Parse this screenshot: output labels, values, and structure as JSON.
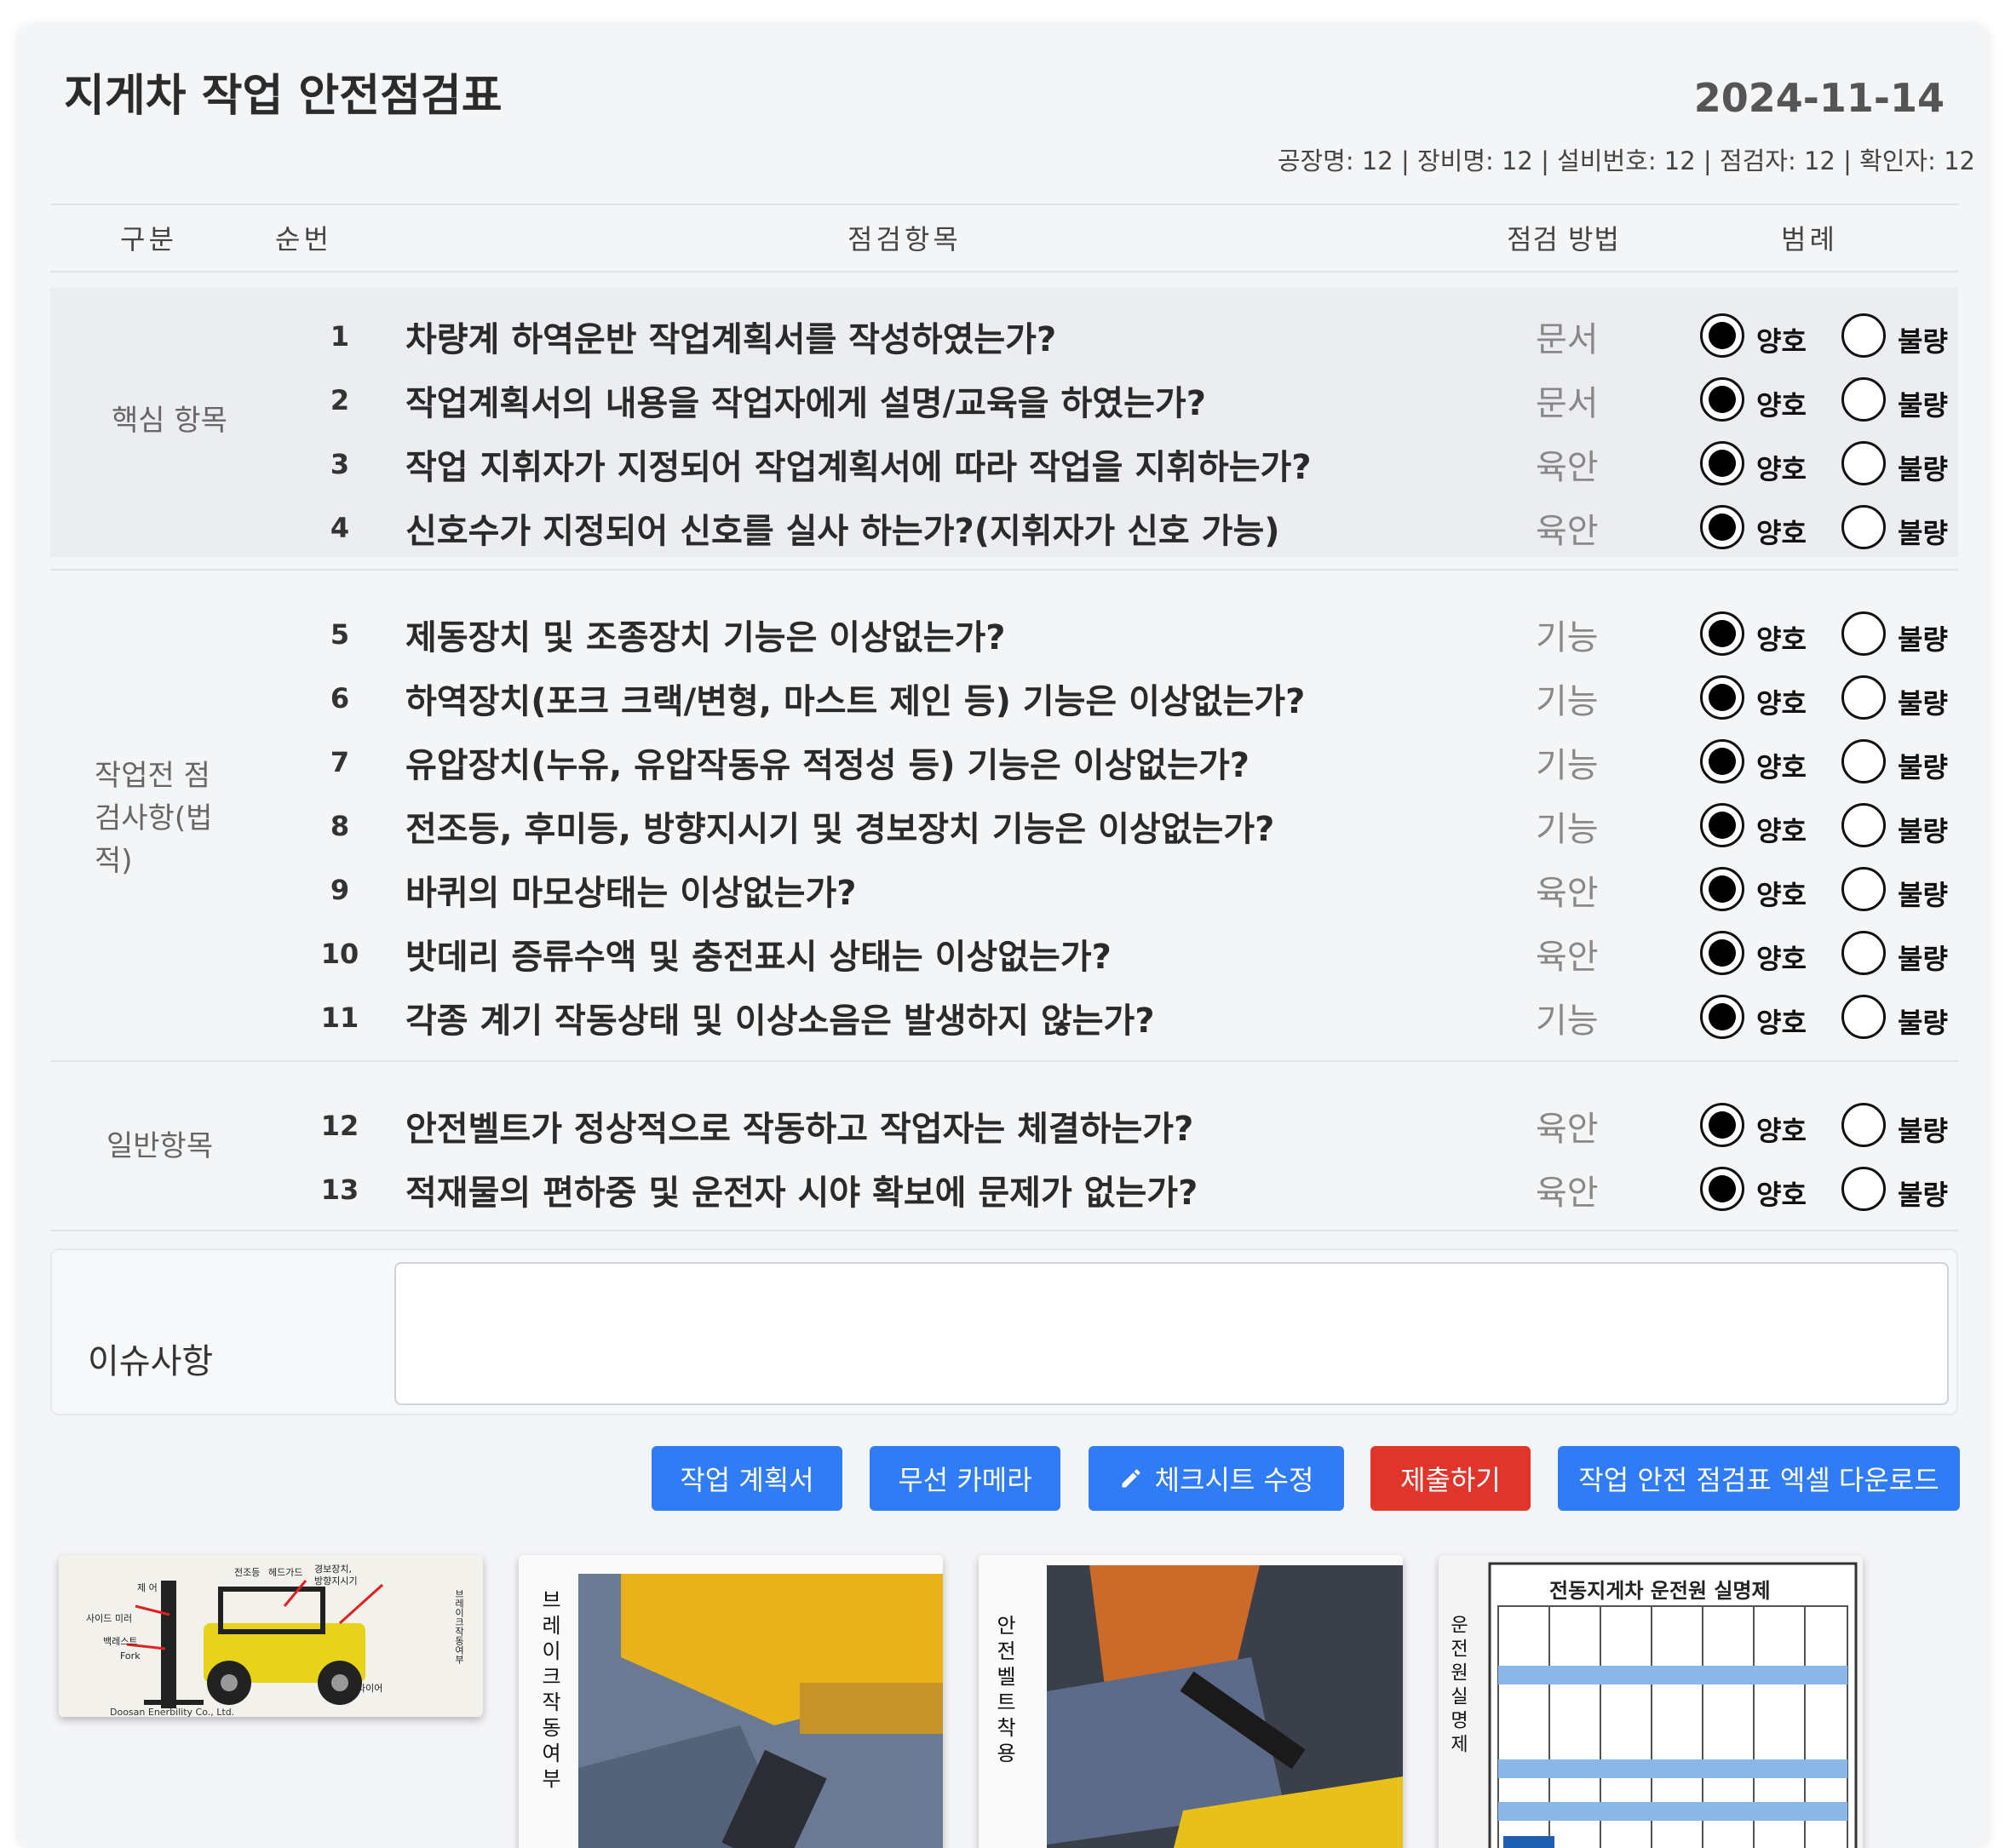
{
  "title": "지게차 작업 안전점검표",
  "date": "2024-11-14",
  "meta": [
    {
      "label": "공장명: 12 | "
    },
    {
      "label": "장비명: 12 | "
    },
    {
      "label": "설비번호: 12 | "
    },
    {
      "label": "점검자: 12 | "
    },
    {
      "label": "확인자: 12"
    }
  ],
  "columns": {
    "category": "구분",
    "number": "순번",
    "item": "점검항목",
    "method": "점검 방법",
    "legend": "범례"
  },
  "options": {
    "good": "양호",
    "bad": "불량"
  },
  "sections": [
    {
      "label": "핵심 항목",
      "rows": [
        {
          "num": "1",
          "question": "차량계 하역운반 작업계획서를 작성하였는가?",
          "method": "문서",
          "good": true
        },
        {
          "num": "2",
          "question": "작업계획서의 내용을 작업자에게 설명/교육을 하였는가?",
          "method": "문서",
          "good": true
        },
        {
          "num": "3",
          "question": "작업 지휘자가 지정되어 작업계획서에 따라 작업을 지휘하는가?",
          "method": "육안",
          "good": true
        },
        {
          "num": "4",
          "question": "신호수가 지정되어 신호를 실사 하는가?(지휘자가 신호 가능)",
          "method": "육안",
          "good": true
        }
      ]
    },
    {
      "label": "작업전 점검사항(법적)",
      "label_lines": [
        "작업전 점",
        "검사항(법",
        "적)"
      ],
      "rows": [
        {
          "num": "5",
          "question": "제동장치 및 조종장치 기능은 이상없는가?",
          "method": "기능",
          "good": true
        },
        {
          "num": "6",
          "question": "하역장치(포크 크랙/변형, 마스트 제인 등) 기능은 이상없는가?",
          "method": "기능",
          "good": true
        },
        {
          "num": "7",
          "question": "유압장치(누유, 유압작동유 적정성 등) 기능은 이상없는가?",
          "method": "기능",
          "good": true
        },
        {
          "num": "8",
          "question": "전조등, 후미등, 방향지시기 및 경보장치 기능은 이상없는가?",
          "method": "기능",
          "good": true
        },
        {
          "num": "9",
          "question": "바퀴의 마모상태는 이상없는가?",
          "method": "육안",
          "good": true
        },
        {
          "num": "10",
          "question": "밧데리 증류수액 및 충전표시 상태는 이상없는가?",
          "method": "육안",
          "good": true
        },
        {
          "num": "11",
          "question": "각종 계기 작동상태 및 이상소음은 발생하지 않는가?",
          "method": "기능",
          "good": true
        }
      ]
    },
    {
      "label": "일반항목",
      "rows": [
        {
          "num": "12",
          "question": "안전벨트가 정상적으로 작동하고 작업자는 체결하는가?",
          "method": "육안",
          "good": true
        },
        {
          "num": "13",
          "question": "적재물의 편하중 및 운전자 시야 확보에 문제가 없는가?",
          "method": "육안",
          "good": true
        }
      ]
    }
  ],
  "issue": {
    "label": "이슈사항",
    "value": ""
  },
  "buttons": {
    "work_plan": "작업 계획서",
    "wireless_camera": "무선 카메라",
    "edit_checksheet": "체크시트 수정",
    "submit": "제출하기",
    "excel_download": "작업 안전 점검표 엑셀 다운로드"
  },
  "photos": [
    {
      "kind": "forklift-diagram",
      "labels": [
        "전조등",
        "헤드가드",
        "경보장치,",
        "방향지시기",
        "제 어",
        "사이드 미러",
        "백레스트",
        "Fork",
        "타이어",
        "브레이크작동여부"
      ],
      "footer": "Doosan Enerbility Co., Ltd."
    },
    {
      "kind": "brake-check",
      "caption": "브레이크작동여부"
    },
    {
      "kind": "seatbelt",
      "caption": "안전벨트착용"
    },
    {
      "kind": "operator-board",
      "caption": "운전원실명제",
      "board_title": "전동지게차 운전원 실명제"
    }
  ],
  "colors": {
    "primary": "#2f7cf6",
    "danger": "#e0352b",
    "card_bg": "#f4f5f7",
    "core_section_bg": "#ebedf0"
  }
}
